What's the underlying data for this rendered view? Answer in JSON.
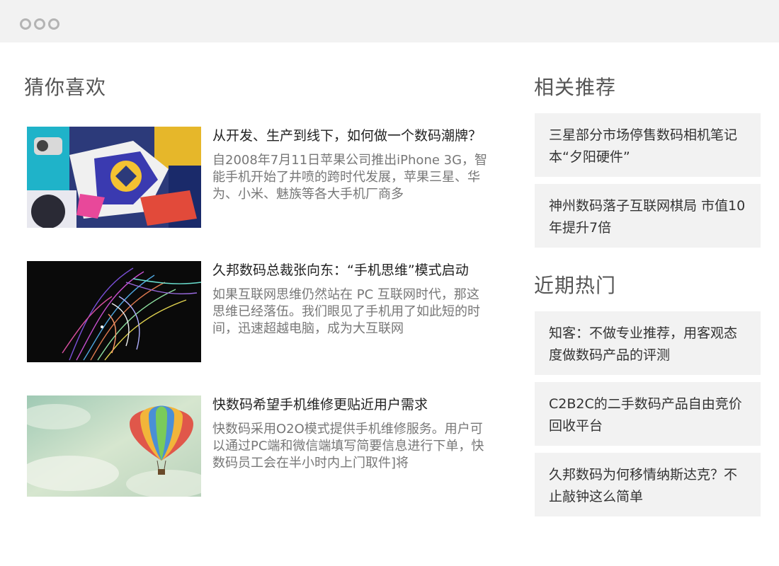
{
  "window": {
    "controls": [
      "dot",
      "dot",
      "dot"
    ]
  },
  "sections": {
    "guess": "猜你喜欢",
    "related": "相关推荐",
    "hot": "近期热门"
  },
  "articles": [
    {
      "title": "从开发、生产到线下，如何做一个数码潮牌？",
      "desc": "自2008年7月11日苹果公司推出iPhone 3G，智能手机开始了井喷的跨时代发展，苹果三星、华为、小米、魅族等各大手机厂商多",
      "image": "phone-sticker-case"
    },
    {
      "title": "久邦数码总裁张向东：“手机思维”模式启动",
      "desc": "如果互联网思维仍然站在 PC 互联网时代，那这思维已经落伍。我们眼见了手机用了如此短的时间，迅速超越电脑，成为大互联网",
      "image": "colorful-line-portrait"
    },
    {
      "title": "快数码希望手机维修更贴近用户需求",
      "desc": "快数码采用O2O模式提供手机维修服务。用户可以通过PC端和微信端填写简要信息进行下单，快数码员工会在半小时内上门取件]将",
      "image": "hot-air-balloon"
    }
  ],
  "related": [
    "三星部分市场停售数码相机笔记本“夕阳硬件”",
    "神州数码落子互联网棋局 市值10年提升7倍"
  ],
  "hot": [
    "知客：不做专业推荐，用客观态度做数码产品的评测",
    "C2B2C的二手数码产品自由竞价回收平台",
    "久邦数码为何移情纳斯达克？不止敲钟这么简单"
  ],
  "colors": {
    "titlebar": "#f2f2f2",
    "card": "#f2f2f2",
    "heading": "#555555",
    "desc": "#777777"
  }
}
